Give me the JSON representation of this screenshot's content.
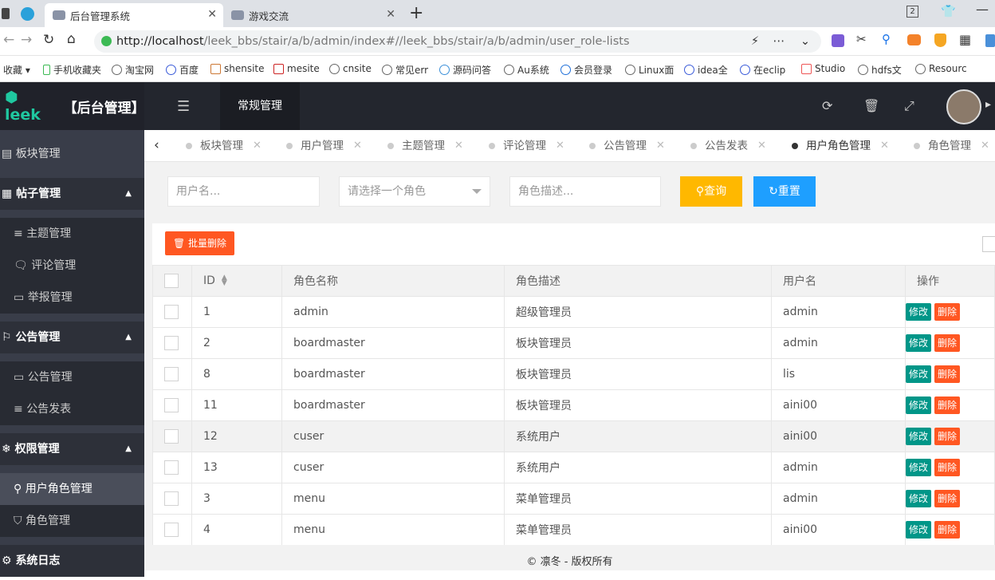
{
  "browser": {
    "tabs": [
      {
        "label": "后台管理系统",
        "active": true
      },
      {
        "label": "游戏交流",
        "active": false
      }
    ],
    "new_tab": "+",
    "url_host": "http://localhost",
    "url_path": "/leek_bbs/stair/a/b/admin/index#//leek_bbs/stair/a/b/admin/user_role-lists",
    "bookmarks": [
      "收藏",
      "手机收藏夹",
      "淘宝网",
      "百度",
      "shensite",
      "mesite",
      "cnsite",
      "常见err",
      "源码问答",
      "Au系统",
      "会员登录",
      "Linux面",
      "idea全",
      "在eclip",
      "Studio",
      "hdfs文",
      "Resourc"
    ]
  },
  "header": {
    "logo_text": "leek",
    "title": "【后台管理】",
    "nav_tab": "常规管理"
  },
  "sidebar": {
    "items": [
      {
        "label": "板块管理",
        "type": "group"
      },
      {
        "label": "帖子管理",
        "type": "group"
      },
      {
        "label": "主题管理",
        "type": "sub"
      },
      {
        "label": "评论管理",
        "type": "sub"
      },
      {
        "label": "举报管理",
        "type": "sub"
      },
      {
        "label": "公告管理",
        "type": "group"
      },
      {
        "label": "公告管理",
        "type": "sub"
      },
      {
        "label": "公告发表",
        "type": "sub"
      },
      {
        "label": "权限管理",
        "type": "group"
      },
      {
        "label": "用户角色管理",
        "type": "sub",
        "selected": true
      },
      {
        "label": "角色管理",
        "type": "sub"
      },
      {
        "label": "系统日志",
        "type": "group"
      }
    ]
  },
  "page_tabs": [
    "板块管理",
    "用户管理",
    "主题管理",
    "评论管理",
    "公告管理",
    "公告发表",
    "用户角色管理",
    "角色管理"
  ],
  "search": {
    "username_placeholder": "用户名...",
    "role_placeholder": "请选择一个角色",
    "desc_placeholder": "角色描述...",
    "query_label": "查询",
    "reset_label": "重置"
  },
  "batch_delete_label": "批量删除",
  "table": {
    "columns": [
      "ID",
      "角色名称",
      "角色描述",
      "用户名",
      "操作"
    ],
    "edit_label": "修改",
    "delete_label": "删除",
    "rows": [
      {
        "id": "1",
        "role": "admin",
        "desc": "超级管理员",
        "user": "admin"
      },
      {
        "id": "2",
        "role": "boardmaster",
        "desc": "板块管理员",
        "user": "admin"
      },
      {
        "id": "8",
        "role": "boardmaster",
        "desc": "板块管理员",
        "user": "lis"
      },
      {
        "id": "11",
        "role": "boardmaster",
        "desc": "板块管理员",
        "user": "aini00"
      },
      {
        "id": "12",
        "role": "cuser",
        "desc": "系统用户",
        "user": "aini00"
      },
      {
        "id": "13",
        "role": "cuser",
        "desc": "系统用户",
        "user": "admin"
      },
      {
        "id": "3",
        "role": "menu",
        "desc": "菜单管理员",
        "user": "admin"
      },
      {
        "id": "4",
        "role": "menu",
        "desc": "菜单管理员",
        "user": "aini00"
      }
    ]
  },
  "footer": "© 凛冬 - 版权所有",
  "colors": {
    "edit": "#009688",
    "delete": "#ff5722",
    "query": "#ffb800",
    "reset": "#1e9fff",
    "sidebar": "#393d49"
  }
}
